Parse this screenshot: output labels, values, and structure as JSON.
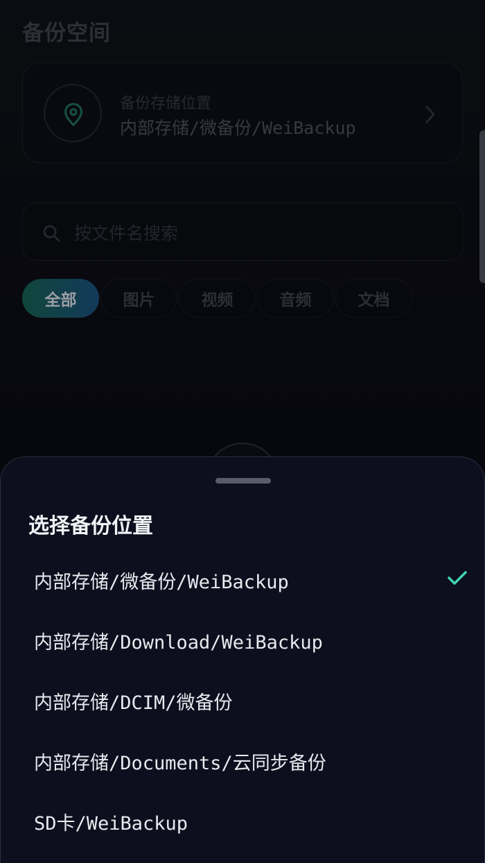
{
  "page": {
    "title": "备份空间"
  },
  "location_card": {
    "label": "备份存储位置",
    "value": "内部存储/微备份/WeiBackup",
    "icon": "location-pin-icon",
    "chevron_icon": "chevron-right-icon"
  },
  "search": {
    "placeholder": "按文件名搜索",
    "value": "",
    "icon": "search-icon"
  },
  "filters": {
    "items": [
      {
        "label": "全部",
        "active": true
      },
      {
        "label": "图片",
        "active": false
      },
      {
        "label": "视频",
        "active": false
      },
      {
        "label": "音频",
        "active": false
      },
      {
        "label": "文档",
        "active": false
      }
    ]
  },
  "sheet": {
    "title": "选择备份位置",
    "options": [
      {
        "label": "内部存储/微备份/WeiBackup",
        "selected": true
      },
      {
        "label": "内部存储/Download/WeiBackup",
        "selected": false
      },
      {
        "label": "内部存储/DCIM/微备份",
        "selected": false
      },
      {
        "label": "内部存储/Documents/云同步备份",
        "selected": false
      },
      {
        "label": "SD卡/WeiBackup",
        "selected": false
      }
    ],
    "check_icon": "check-icon"
  },
  "colors": {
    "accent": "#3fd6b1",
    "sheet_background": "#0e0f1e",
    "chip_gradient_start": "#165e50",
    "chip_gradient_end": "#1a4d79"
  }
}
